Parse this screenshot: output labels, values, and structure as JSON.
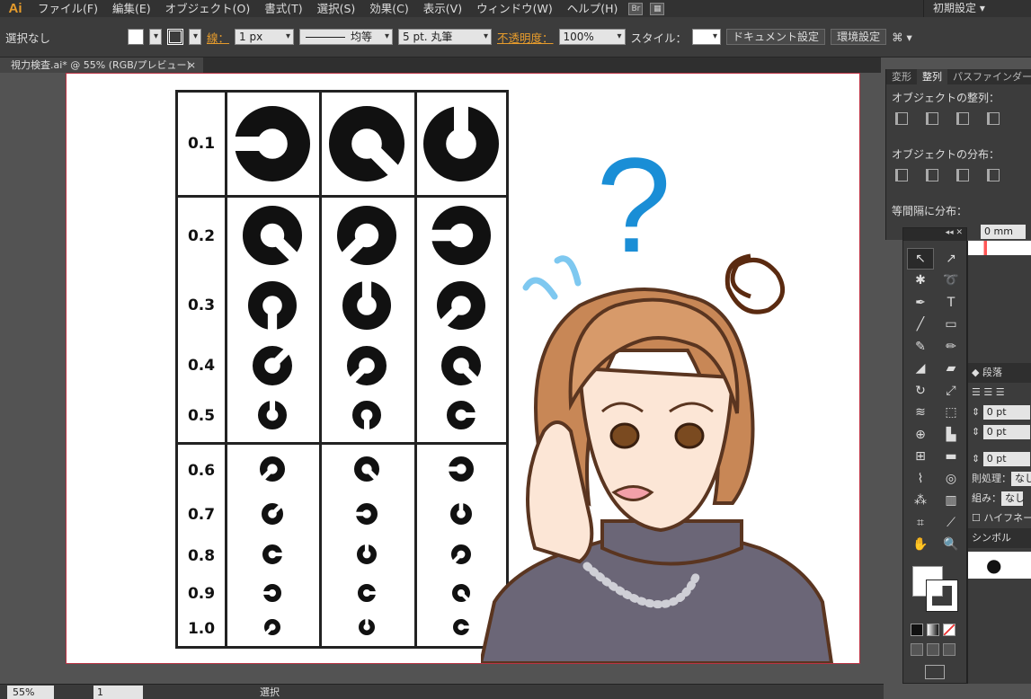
{
  "menubar": {
    "logo": "Ai",
    "items": [
      "ファイル(F)",
      "編集(E)",
      "オブジェクト(O)",
      "書式(T)",
      "選択(S)",
      "効果(C)",
      "表示(V)",
      "ウィンドウ(W)",
      "ヘルプ(H)"
    ],
    "bridge_icon": "Br",
    "workspace": "初期設定"
  },
  "control": {
    "selection": "選択なし",
    "stroke_label": "線：",
    "stroke_weight": "1 px",
    "profile": "均等",
    "brush": "5 pt. 丸筆",
    "opacity_label": "不透明度：",
    "opacity": "100%",
    "style_label": "スタイル：",
    "doc_settings": "ドキュメント設定",
    "prefs": "環境設定"
  },
  "document_tab": {
    "title": "視力検査.ai* @ 55% (RGB/プレビュー)",
    "close": "×"
  },
  "chart": {
    "acuity": [
      "0.1",
      "0.2",
      "0.3",
      "0.4",
      "0.5",
      "0.6",
      "0.7",
      "0.8",
      "0.9",
      "1.0"
    ]
  },
  "illustration": {
    "question_mark": "?"
  },
  "status": {
    "zoom": "55%",
    "page": "1",
    "tool": "選択"
  },
  "align_panel": {
    "tabs": [
      "変形",
      "整列",
      "パスファインダー"
    ],
    "align_objects": "オブジェクトの整列：",
    "distribute_objects": "オブジェクトの分布：",
    "distribute_spacing": "等間隔に分布：",
    "spacing_value": "0 mm"
  },
  "right_panel": {
    "tab": "段落",
    "indent1": "0 pt",
    "indent2": "0 pt",
    "indent3": "0 pt",
    "kinsoku_label": "則処理：",
    "kinsoku_value": "なし",
    "mojikumi_label": "組み：",
    "mojikumi_value": "なし",
    "hyphenation": "ハイフネーシ",
    "symbols": "シンボル"
  },
  "colors": {
    "accent": "#e79c2c",
    "question": "#1a8ed6",
    "ring": "#111111"
  }
}
